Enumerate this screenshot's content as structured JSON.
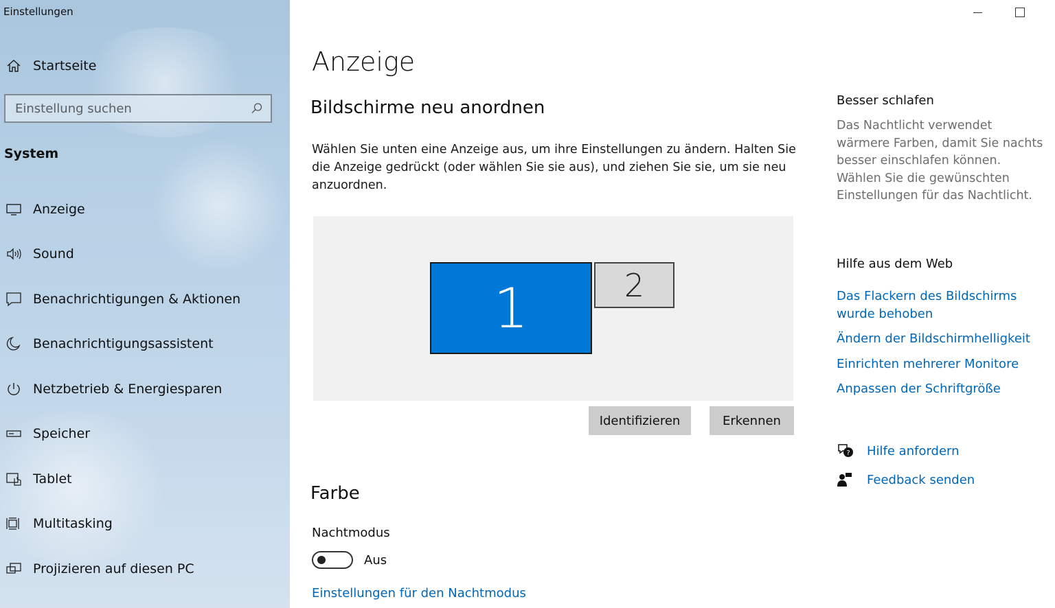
{
  "window": {
    "title": "Einstellungen",
    "controls": {
      "minimize": "minimize-icon",
      "maximize": "maximize-icon"
    }
  },
  "sidebar": {
    "home_label": "Startseite",
    "search": {
      "placeholder": "Einstellung suchen",
      "value": ""
    },
    "section_label": "System",
    "items": [
      {
        "label": "Anzeige",
        "icon": "display-icon"
      },
      {
        "label": "Sound",
        "icon": "speaker-icon"
      },
      {
        "label": "Benachrichtigungen & Aktionen",
        "icon": "notification-icon"
      },
      {
        "label": "Benachrichtigungsassistent",
        "icon": "moon-icon"
      },
      {
        "label": "Netzbetrieb & Energiesparen",
        "icon": "power-icon"
      },
      {
        "label": "Speicher",
        "icon": "storage-icon"
      },
      {
        "label": "Tablet",
        "icon": "tablet-icon"
      },
      {
        "label": "Multitasking",
        "icon": "multitasking-icon"
      },
      {
        "label": "Projizieren auf diesen PC",
        "icon": "project-icon"
      }
    ]
  },
  "main": {
    "title": "Anzeige",
    "rearrange": {
      "heading": "Bildschirme neu anordnen",
      "description": "Wählen Sie unten eine Anzeige aus, um ihre Einstellungen zu ändern. Halten Sie die Anzeige gedrückt (oder wählen Sie sie aus), und ziehen Sie sie, um sie neu anzuordnen.",
      "monitors": [
        {
          "number": "1",
          "selected": true
        },
        {
          "number": "2",
          "selected": false
        }
      ],
      "identify_label": "Identifizieren",
      "detect_label": "Erkennen"
    },
    "color": {
      "heading": "Farbe",
      "night_mode_label": "Nachtmodus",
      "night_mode_state": "Aus",
      "night_mode_on": false,
      "night_settings_link": "Einstellungen für den Nachtmodus"
    }
  },
  "right_panel": {
    "sleep": {
      "heading": "Besser schlafen",
      "text": "Das Nachtlicht verwendet wärmere Farben, damit Sie nachts besser einschlafen können. Wählen Sie die gewünschten Einstellungen für das Nachtlicht."
    },
    "web_help": {
      "heading": "Hilfe aus dem Web",
      "links": [
        "Das Flackern des Bildschirms wurde behoben",
        "Ändern der Bildschirmhelligkeit",
        "Einrichten mehrerer Monitore",
        "Anpassen der Schriftgröße"
      ]
    },
    "get_help": "Hilfe anfordern",
    "feedback": "Feedback senden"
  },
  "colors": {
    "accent": "#0078d7",
    "link": "#0067b8",
    "sidebar_bg": "#b8d1e6"
  }
}
